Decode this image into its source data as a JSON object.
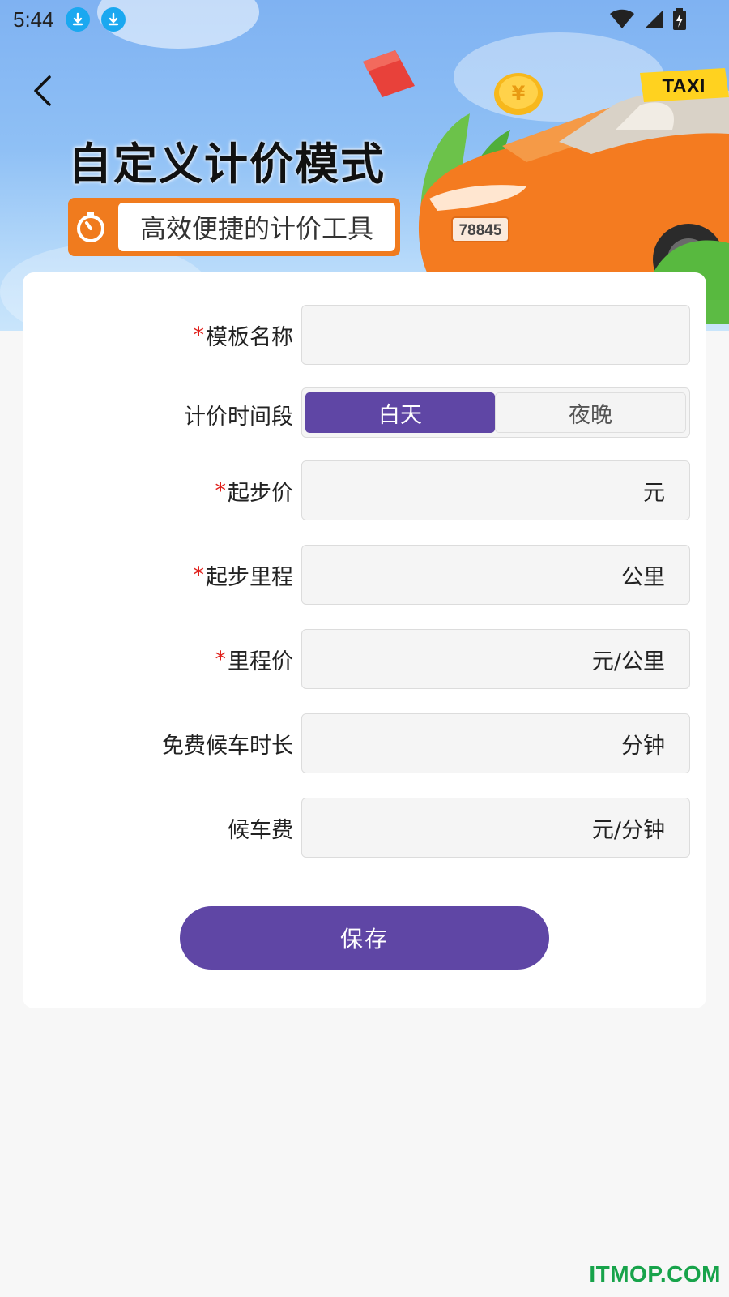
{
  "status_bar": {
    "time": "5:44"
  },
  "banner": {
    "title": "自定义计价模式",
    "subtitle": "高效便捷的计价工具",
    "taxi_sign": "TAXI",
    "plate": "78845"
  },
  "form": {
    "template_name": {
      "label": "模板名称",
      "required": true,
      "value": ""
    },
    "period": {
      "label": "计价时间段",
      "options": [
        "白天",
        "夜晚"
      ],
      "selected": "白天"
    },
    "base_price": {
      "label": "起步价",
      "required": true,
      "unit": "元"
    },
    "base_distance": {
      "label": "起步里程",
      "required": true,
      "unit": "公里"
    },
    "distance_price": {
      "label": "里程价",
      "required": true,
      "unit": "元/公里"
    },
    "free_wait": {
      "label": "免费候车时长",
      "required": false,
      "unit": "分钟"
    },
    "wait_fee": {
      "label": "候车费",
      "required": false,
      "unit": "元/分钟"
    },
    "required_mark": "*",
    "save_label": "保存"
  },
  "watermark": "ITMOP.COM",
  "colors": {
    "primary": "#5f46a5",
    "badge": "#f07b1e",
    "required": "#e0201b",
    "download_icon": "#1aa8f0"
  }
}
